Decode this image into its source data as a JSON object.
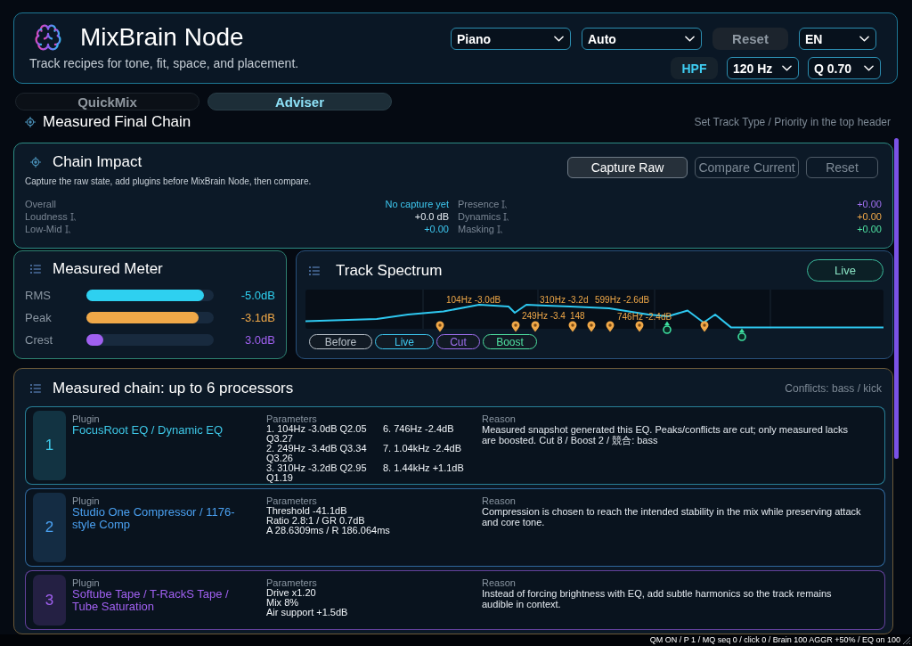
{
  "header": {
    "title": "MixBrain Node",
    "subtitle": "Track recipes for tone, fit, space, and placement.",
    "controls_top": [
      {
        "kind": "select",
        "value": "Piano"
      },
      {
        "kind": "select",
        "value": "Auto"
      },
      {
        "kind": "button",
        "label": "Reset"
      },
      {
        "kind": "select",
        "value": "EN"
      }
    ],
    "controls_bottom": [
      {
        "kind": "toggle",
        "label": "HPF",
        "on": true
      },
      {
        "kind": "select",
        "value": "120 Hz"
      },
      {
        "kind": "select",
        "value": "Q 0.70"
      }
    ]
  },
  "tabs": [
    {
      "label": "QuickMix",
      "selected": false
    },
    {
      "label": "Adviser",
      "selected": true
    }
  ],
  "section": {
    "title": "Measured Final Chain",
    "hint": "Set Track Type / Priority in the top header"
  },
  "chain_impact": {
    "title": "Chain Impact",
    "description": "Capture the raw state, add plugins before MixBrain Node, then compare.",
    "buttons": [
      {
        "label": "Capture Raw",
        "disabled": false
      },
      {
        "label": "Compare Current",
        "disabled": true
      },
      {
        "label": "Reset",
        "disabled": true
      }
    ],
    "metrics": [
      {
        "label": "Overall",
        "value": "No capture yet",
        "color": "#3ec8f0",
        "hint": false
      },
      {
        "label": "Presence",
        "value": "+0.00",
        "color": "#a070f0",
        "hint": true
      },
      {
        "label": "Loudness",
        "value": "+0.0 dB",
        "color": "#e8eef4",
        "hint": true
      },
      {
        "label": "Dynamics",
        "value": "+0.00",
        "color": "#f0a848",
        "hint": true
      },
      {
        "label": "Low-Mid",
        "value": "+0.00",
        "color": "#3ec8f0",
        "hint": true
      },
      {
        "label": "Masking",
        "value": "+0.00",
        "color": "#4ee0a0",
        "hint": true
      }
    ]
  },
  "meter": {
    "title": "Measured Meter",
    "rows": [
      {
        "label": "RMS",
        "level": 0.92,
        "reading": "-5.0dB",
        "color": "#2ed0f0"
      },
      {
        "label": "Peak",
        "level": 0.88,
        "reading": "-3.1dB",
        "color": "#f0a848"
      },
      {
        "label": "Crest",
        "level": 0.13,
        "reading": "3.0dB",
        "color": "#a060f0"
      }
    ]
  },
  "spectrum": {
    "title": "Track Spectrum",
    "live_button": "Live",
    "labels": [
      "104Hz -3.0dB",
      "310Hz -3.2d",
      "599Hz -2.6dB",
      "249Hz -3.4",
      "148",
      "746Hz -2.4dB"
    ],
    "markers": [
      {
        "kind": "cut"
      },
      {
        "kind": "cut"
      },
      {
        "kind": "cut"
      },
      {
        "kind": "cut"
      },
      {
        "kind": "cut"
      },
      {
        "kind": "cut"
      },
      {
        "kind": "cut"
      },
      {
        "kind": "boost"
      },
      {
        "kind": "cut"
      },
      {
        "kind": "boost"
      }
    ],
    "legend": [
      {
        "label": "Before",
        "color": "#b8c0c8"
      },
      {
        "label": "Live",
        "color": "#3ec8f0"
      },
      {
        "label": "Cut",
        "color": "#a070f0"
      },
      {
        "label": "Boost",
        "color": "#4ee0a0"
      }
    ]
  },
  "chain": {
    "title": "Measured chain: up to 6 processors",
    "conflicts": "Conflicts: bass / kick",
    "rows": [
      {
        "number": "1",
        "plugin_label": "Plugin",
        "plugin": "FocusRoot EQ / Dynamic EQ",
        "parameters_label": "Parameters",
        "parameters": [
          [
            "1. 104Hz -3.0dB Q2.05 Q3.27",
            "2. 249Hz -3.4dB Q3.34 Q3.26",
            "3. 310Hz -3.2dB Q2.95 Q1.19"
          ],
          [
            "6. 746Hz -2.4dB",
            "7. 1.04kHz -2.4dB",
            "8. 1.44kHz +1.1dB"
          ]
        ],
        "reason_label": "Reason",
        "reason": "Measured snapshot generated this EQ. Peaks/conflicts are cut; only measured lacks are boosted. Cut 8 / Boost 2 / 競合: bass",
        "color": "#3ec8e8"
      },
      {
        "number": "2",
        "plugin_label": "Plugin",
        "plugin": "Studio One Compressor / 1176-style Comp",
        "parameters_label": "Parameters",
        "parameters": [
          [
            "Threshold -41.1dB",
            "Ratio 2.8:1 / GR 0.7dB",
            "A 28.6309ms / R 186.064ms"
          ]
        ],
        "reason_label": "Reason",
        "reason": "Compression is chosen to reach the intended stability in the mix while preserving attack and core tone.",
        "color": "#4aa0f0"
      },
      {
        "number": "3",
        "plugin_label": "Plugin",
        "plugin": "Softube Tape / T-RackS Tape / Tube Saturation",
        "parameters_label": "Parameters",
        "parameters": [
          [
            "Drive x1.20",
            "Mix 8%",
            "Air support +1.5dB"
          ]
        ],
        "reason_label": "Reason",
        "reason": "Instead of forcing brightness with EQ, add subtle harmonics so the track remains audible in context.",
        "color": "#a060f0"
      }
    ]
  },
  "status_bar": "QM ON / P 1 / MQ seq 0 / click 0 / Brain 100 AGGR +50% / EQ on 100"
}
